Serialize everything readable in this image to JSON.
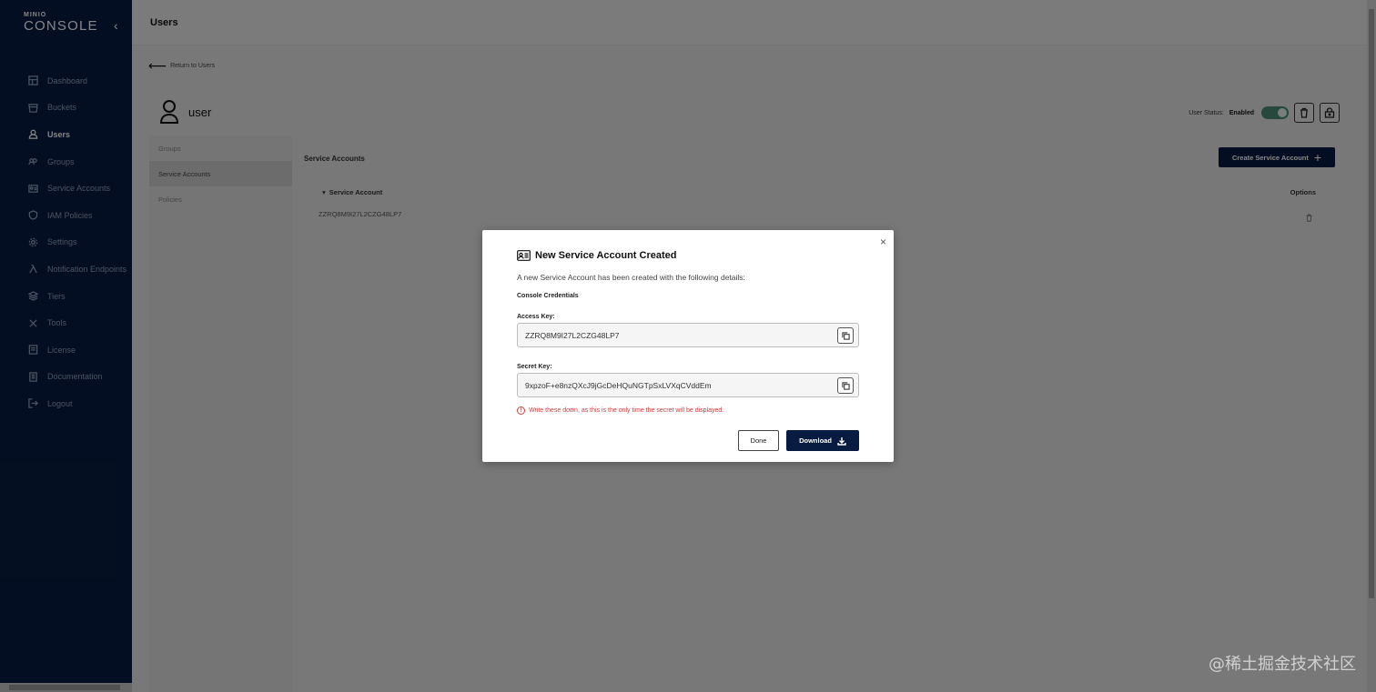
{
  "brand": {
    "small": "MINIO",
    "big": "CONSOLE"
  },
  "sidebar": {
    "items": [
      {
        "label": "Dashboard",
        "icon": "dashboard-icon"
      },
      {
        "label": "Buckets",
        "icon": "bucket-icon"
      },
      {
        "label": "Users",
        "icon": "user-icon",
        "active": true
      },
      {
        "label": "Groups",
        "icon": "groups-icon"
      },
      {
        "label": "Service Accounts",
        "icon": "service-accounts-icon"
      },
      {
        "label": "IAM Policies",
        "icon": "shield-icon"
      },
      {
        "label": "Settings",
        "icon": "gear-icon"
      },
      {
        "label": "Notification Endpoints",
        "icon": "lambda-icon"
      },
      {
        "label": "Tiers",
        "icon": "tiers-icon"
      },
      {
        "label": "Tools",
        "icon": "tools-icon"
      },
      {
        "label": "License",
        "icon": "license-icon"
      },
      {
        "label": "Documentation",
        "icon": "documentation-icon"
      },
      {
        "label": "Logout",
        "icon": "logout-icon"
      }
    ]
  },
  "header": {
    "title": "Users"
  },
  "page": {
    "back_label": "Return to Users",
    "user_name": "user",
    "status_label": "User Status:",
    "status_value": "Enabled",
    "tabs": [
      {
        "label": "Groups"
      },
      {
        "label": "Service Accounts",
        "active": true
      },
      {
        "label": "Policies"
      }
    ],
    "panel_title": "Service Accounts",
    "create_button": "Create Service Account",
    "table": {
      "col_service_account": "Service Account",
      "col_options": "Options",
      "rows": [
        "ZZRQ8M9I27L2CZG48LP7"
      ]
    }
  },
  "modal": {
    "title": "New Service Account Created",
    "description": "A new Service Account has been created with the following details:",
    "subtitle": "Console Credentials",
    "access_key_label": "Access Key:",
    "access_key_value": "ZZRQ8M9I27L2CZG48LP7",
    "secret_key_label": "Secret Key:",
    "secret_key_value": "9xpzoF+e8nzQXcJ9jGcDeHQuNGTpSxLVXqCVddEm",
    "warning": "Write these down, as this is the only time the secret will be displayed.",
    "done_label": "Done",
    "download_label": "Download"
  },
  "watermark": "@稀土掘金技术社区",
  "colors": {
    "sidebar_bg": "#081c42",
    "primary": "#081c42",
    "toggle_on": "#4a8a75",
    "warning": "#d43a3a"
  }
}
